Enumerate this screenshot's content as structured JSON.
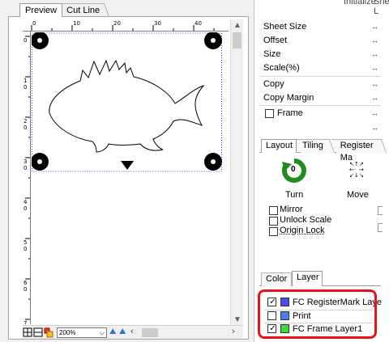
{
  "tabs": {
    "preview": "Preview",
    "cut_line": "Cut Line"
  },
  "header_partial": {
    "initialize": "Initialize",
    "sheet": "Sheet L"
  },
  "ruler": {
    "h_labels": [
      "0",
      "10",
      "20",
      "30",
      "40"
    ],
    "v_labels": [
      "0",
      "1\n0",
      "2\n0",
      "3\n0",
      "4\n0",
      "5\n0",
      "6\n0",
      "7\n0"
    ]
  },
  "zoom": {
    "value": "200%"
  },
  "properties": {
    "items": [
      {
        "label": "Sheet Size",
        "arrow": "↔"
      },
      {
        "label": "Offset",
        "arrow": "↔"
      },
      {
        "label": "Size",
        "arrow": "↔"
      },
      {
        "label": "Scale(%)",
        "arrow": "↔"
      },
      {
        "label": "Copy",
        "arrow": "↔"
      },
      {
        "label": "Copy Margin",
        "arrow": "↔"
      },
      {
        "label": "Frame",
        "arrow": "↔"
      },
      {
        "label": "",
        "arrow": "↔"
      }
    ],
    "frame_checked": false
  },
  "layout_tabs": [
    "Layout",
    "Tiling",
    "Register Ma"
  ],
  "layout_panel": {
    "turn_label": "Turn",
    "turn_value": "0",
    "move_label": "Move",
    "options": [
      {
        "label": "Mirror",
        "checked": false
      },
      {
        "label": "Unlock Scale",
        "checked": false
      },
      {
        "label": "Origin Lock",
        "checked": false
      }
    ]
  },
  "bottom_tabs": [
    "Color",
    "Layer"
  ],
  "layers": [
    {
      "name": "FC RegisterMark Laye",
      "checked": true,
      "color": "#4a4df0"
    },
    {
      "name": "Print",
      "checked": false,
      "color": "#4a7ff0"
    },
    {
      "name": "FC Frame Layer1",
      "checked": true,
      "color": "#3cdc3c"
    }
  ],
  "colors": {
    "highlight_box": "#e3141b",
    "turn_icon": "#1e8c1e"
  }
}
